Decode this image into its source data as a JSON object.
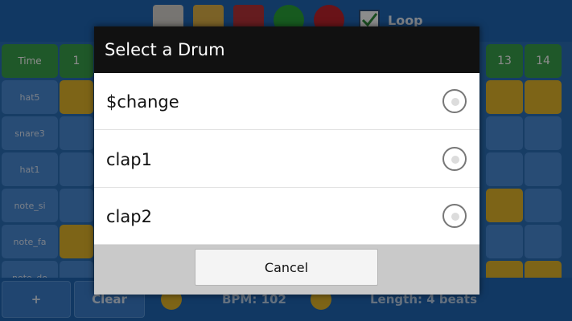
{
  "toolbar": {
    "buttons": [
      {
        "icon": "new-file-icon",
        "color": "#d9d6cf"
      },
      {
        "icon": "open-folder-icon",
        "color": "#e0b347"
      },
      {
        "icon": "save-disk-icon",
        "color": "#b8333a"
      },
      {
        "icon": "play-icon",
        "color": "#2aa43a"
      },
      {
        "icon": "record-icon",
        "color": "#c0242c"
      }
    ],
    "loop_label": "Loop",
    "loop_checked": true
  },
  "grid": {
    "time_label": "Time",
    "step_numbers": [
      "1",
      "13",
      "14"
    ],
    "rows": [
      "hat5",
      "snare3",
      "hat1",
      "note_si",
      "note_fa",
      "note_do"
    ]
  },
  "bottom": {
    "add_label": "+",
    "clear_label": "Clear",
    "bpm_text": "BPM: 102",
    "length_text": "Length: 4 beats"
  },
  "dialog": {
    "title": "Select a Drum",
    "options": [
      {
        "label": "$change",
        "selected": false
      },
      {
        "label": "clap1",
        "selected": false
      },
      {
        "label": "clap2",
        "selected": false
      }
    ],
    "cancel_label": "Cancel"
  }
}
